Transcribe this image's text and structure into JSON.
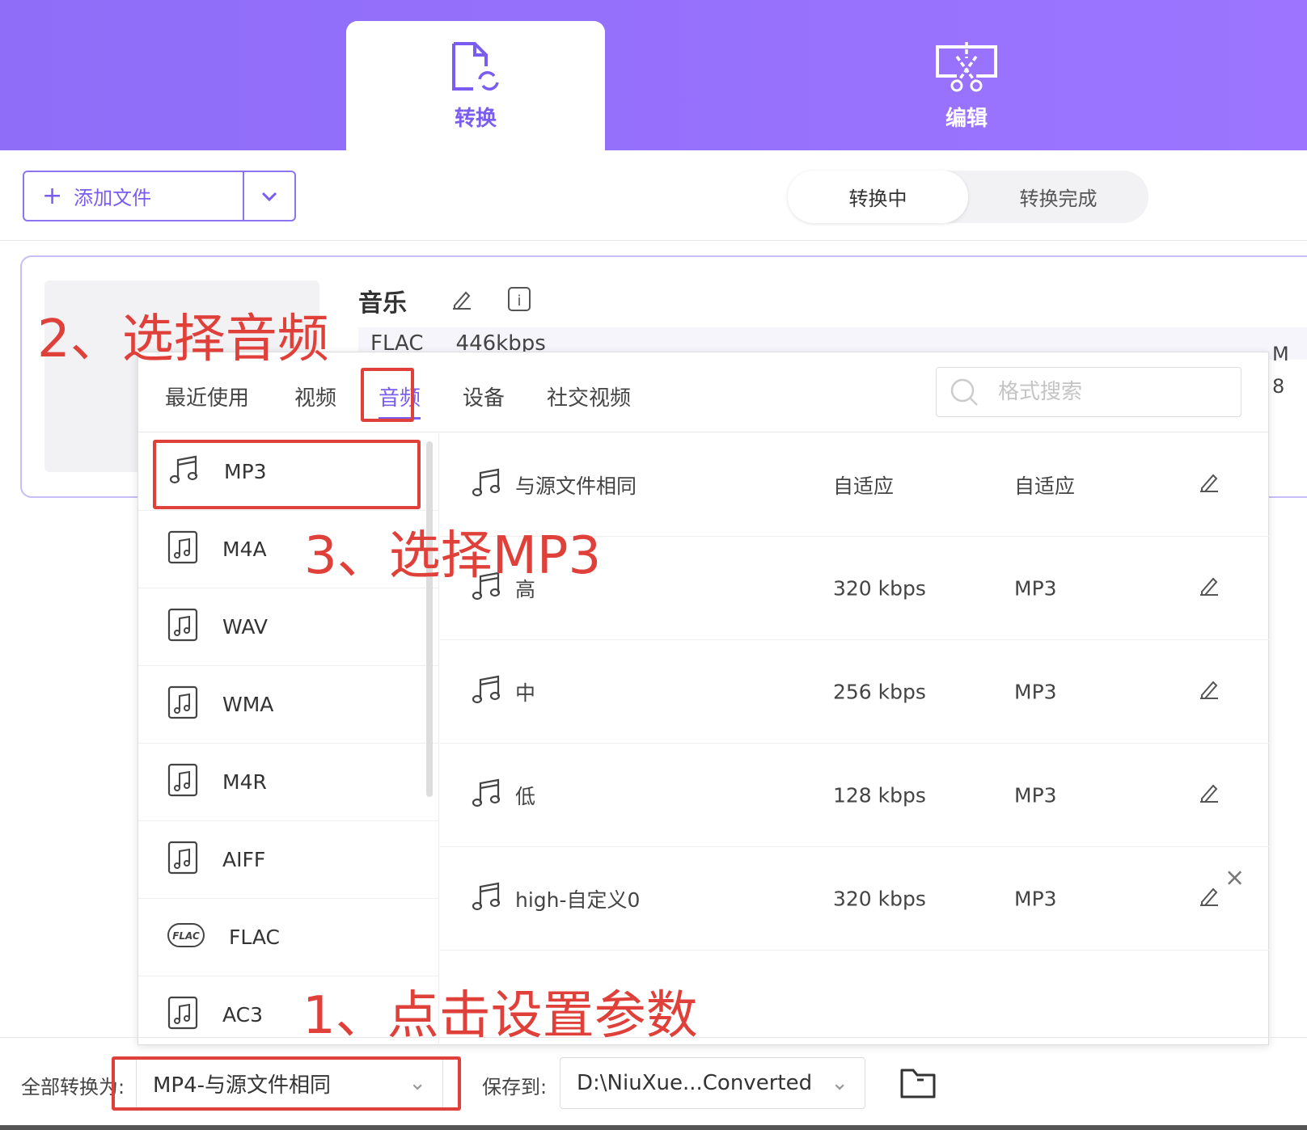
{
  "header": {
    "tabs": [
      {
        "label": "转换",
        "icon": "file-convert-icon",
        "active": true
      },
      {
        "label": "编辑",
        "icon": "scissors-edit-icon",
        "active": false
      }
    ],
    "accent": "#7b5cf0"
  },
  "toolbar": {
    "add_file": "添加文件",
    "segments": [
      "转换中",
      "转换完成"
    ],
    "active_segment": "转换中"
  },
  "file": {
    "title": "音乐",
    "format": "FLAC",
    "bitrate": "446kbps",
    "right_hint_1": "M",
    "right_hint_2": "8"
  },
  "format_panel": {
    "tabs": [
      "最近使用",
      "视频",
      "音频",
      "设备",
      "社交视频"
    ],
    "active_tab": "音频",
    "search_placeholder": "格式搜索",
    "formats": [
      "MP3",
      "M4A",
      "WAV",
      "WMA",
      "M4R",
      "AIFF",
      "FLAC",
      "AC3"
    ],
    "selected_format": "MP3",
    "presets": [
      {
        "name": "与源文件相同",
        "bitrate": "自适应",
        "format": "自适应"
      },
      {
        "name": "高",
        "bitrate": "320 kbps",
        "format": "MP3"
      },
      {
        "name": "中",
        "bitrate": "256 kbps",
        "format": "MP3"
      },
      {
        "name": "低",
        "bitrate": "128 kbps",
        "format": "MP3"
      },
      {
        "name": "high-自定义0",
        "bitrate": "320 kbps",
        "format": "MP3",
        "removable": true
      }
    ]
  },
  "bottom": {
    "convert_all_label": "全部转换为:",
    "convert_all_value": "MP4-与源文件相同",
    "save_label": "保存到:",
    "save_path": "D:\\NiuXue...Converted"
  },
  "annotations": {
    "step1": "1、点击设置参数",
    "step2": "2、选择音频",
    "step3": "3、选择MP3",
    "color": "#e0403a"
  }
}
